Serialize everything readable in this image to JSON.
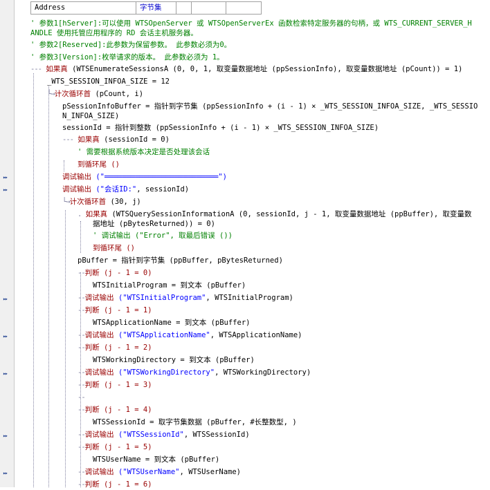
{
  "header": {
    "col1": "Address",
    "col2": "字节集"
  },
  "code": {
    "comment1a": "' 参数1[hServer]:可以使用 WTSOpenServer 或 WTSOpenServerEx 函数检索特定服务器的句柄，或 WTS_CURRENT_SERVER_H",
    "comment1b": "ANDLE 使用托管应用程序的 RD 会话主机服务器。",
    "comment2": "' 参数2[Reserved]:此参数为保留参数。 此参数必须为0。",
    "comment3": "' 参数3[Version]:枚举请求的版本。 此参数必须为 1。",
    "if1_kw": "如果真",
    "if1_rest": " (WTSEnumerateSessionsA (0, 0, 1, 取变量数据地址 (ppSessionInfo), 取变量数据地址 (pCount)) = 1)",
    "size_line": "_WTS_SESSION_INFOA_SIZE = 12",
    "loop1_kw": "计次循环首",
    "loop1_rest": " (pCount, i)",
    "psib_a": "pSessionInfoBuffer = 指针到字节集 (ppSessionInfo + (i - 1) × _WTS_SESSION_INFOA_SIZE, _WTS_SESSIO",
    "psib_b": "N_INFOA_SIZE)",
    "sid_line": "sessionId = 指针到整数 (ppSessionInfo + (i - 1) × _WTS_SESSION_INFOA_SIZE)",
    "if2_kw": "如果真",
    "if2_rest": " (sessionId = 0)",
    "comment4": "' 需要根据系统版本决定是否处理该会话",
    "break1": "到循环尾 ()",
    "dbg1_kw": "调试输出",
    "dbg1_rest": " (\"══════════════════════════\")",
    "dbg2_kw": "调试输出",
    "dbg2_str": " (\"会话ID:\"",
    "dbg2_rest": ", sessionId)",
    "loop2_kw": "计次循环首",
    "loop2_rest": " (30, j)",
    "if3_kw": "如果真",
    "if3_rest_a": " (WTSQuerySessionInformationA (0, sessionId, j - 1, 取变量数据地址 (ppBuffer), 取变量数",
    "if3_rest_b": "据地址 (pBytesReturned)) = 0)",
    "comment5": "' 调试输出 (\"Error\", 取最后错误 ())",
    "break2": "到循环尾 ()",
    "pbuf_line": "pBuffer = 指针到字节集 (ppBuffer, pBytesReturned)",
    "judge0": "判断 (j - 1 = 0)",
    "init_prog": "WTSInitialProgram = 到文本 (pBuffer)",
    "dbg3_kw": "调试输出",
    "dbg3_str": " (\"WTSInitialProgram\"",
    "dbg3_rest": ", WTSInitialProgram)",
    "judge1": "判断 (j - 1 = 1)",
    "app_name": "WTSApplicationName = 到文本 (pBuffer)",
    "dbg4_kw": "调试输出",
    "dbg4_str": " (\"WTSApplicationName\"",
    "dbg4_rest": ", WTSApplicationName)",
    "judge2": "判断 (j - 1 = 2)",
    "work_dir": "WTSWorkingDirectory = 到文本 (pBuffer)",
    "dbg5_kw": "调试输出",
    "dbg5_str": " (\"WTSWorkingDirectory\"",
    "dbg5_rest": ", WTSWorkingDirectory)",
    "judge3": "判断 (j - 1 = 3)",
    "judge4": "判断 (j - 1 = 4)",
    "sess_id": "WTSSessionId = 取字节集数据 (pBuffer, #长整数型, )",
    "dbg6_kw": "调试输出",
    "dbg6_str": " (\"WTSSessionId\"",
    "dbg6_rest": ", WTSSessionId)",
    "judge5": "判断 (j - 1 = 5)",
    "user_name": "WTSUserName = 到文本 (pBuffer)",
    "dbg7_kw": "调试输出",
    "dbg7_str": " (\"WTSUserName\"",
    "dbg7_rest": ", WTSUserName)",
    "judge6": "判断 (j - 1 = 6)"
  },
  "icons": {
    "breakpoint": "double-chevron-icon",
    "collapse": "collapse-arrow-icon"
  },
  "colors": {
    "comment": "#008000",
    "keyword": "#990000",
    "string": "#0000ff",
    "gutter": "#f0f0f0"
  }
}
